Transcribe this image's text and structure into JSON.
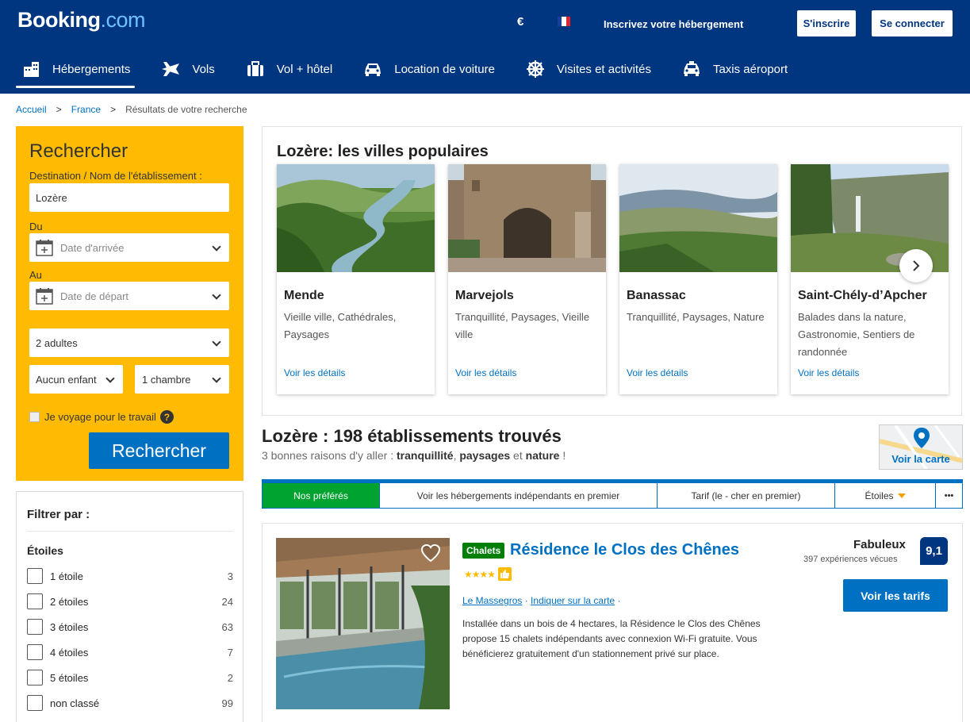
{
  "header": {
    "logo_main": "Booking",
    "logo_suffix": ".com",
    "currency": "€",
    "list_property": "Inscrivez votre hébergement",
    "signup": "S'inscrire",
    "login": "Se connecter"
  },
  "nav": {
    "tabs": [
      {
        "label": "Hébergements",
        "icon": "bed-icon"
      },
      {
        "label": "Vols",
        "icon": "plane-icon"
      },
      {
        "label": "Vol + hôtel",
        "icon": "suitcase-icon"
      },
      {
        "label": "Location de voiture",
        "icon": "car-icon"
      },
      {
        "label": "Visites et activités",
        "icon": "attractions-icon"
      },
      {
        "label": "Taxis aéroport",
        "icon": "taxi-icon"
      }
    ]
  },
  "breadcrumb": {
    "items": [
      "Accueil",
      "France"
    ],
    "current": "Résultats de votre recherche",
    "separator": ">"
  },
  "search": {
    "title": "Rechercher",
    "destination_label": "Destination / Nom de l'établissement :",
    "destination_value": "Lozère",
    "from_label": "Du",
    "checkin_placeholder": "Date d'arrivée",
    "to_label": "Au",
    "checkout_placeholder": "Date de départ",
    "adults": "2 adultes",
    "children": "Aucun enfant",
    "rooms": "1 chambre",
    "work_travel": "Je voyage pour le travail",
    "help": "?",
    "button": "Rechercher"
  },
  "filters": {
    "title": "Filtrer par :",
    "stars_heading": "Étoiles",
    "items": [
      {
        "label": "1 étoile",
        "count": "3"
      },
      {
        "label": "2 étoiles",
        "count": "24"
      },
      {
        "label": "3 étoiles",
        "count": "63"
      },
      {
        "label": "4 étoiles",
        "count": "7"
      },
      {
        "label": "5 étoiles",
        "count": "2"
      },
      {
        "label": "non classé",
        "count": "99"
      }
    ]
  },
  "popular": {
    "title": "Lozère: les villes populaires",
    "cities": [
      {
        "name": "Mende",
        "tags": "Vieille ville, Cathédrales, Paysages",
        "link": "Voir les détails"
      },
      {
        "name": "Marvejols",
        "tags": "Tranquillité, Paysages, Vieille ville",
        "link": "Voir les détails"
      },
      {
        "name": "Banassac",
        "tags": "Tranquillité, Paysages, Nature",
        "link": "Voir les détails"
      },
      {
        "name": "Saint-Chély-d’Apcher",
        "tags": "Balades dans la nature, Gastronomie, Sentiers de randonnée",
        "link": "Voir les détails"
      }
    ]
  },
  "results": {
    "title": "Lozère : 198 établissements trouvés",
    "sub_prefix": "3 bonnes raisons d'y aller : ",
    "reason1": "tranquillité",
    "sep1": ", ",
    "reason2": "paysages",
    "sep2": " et ",
    "reason3": "nature",
    "sub_suffix": " !",
    "map_link": "Voir la carte"
  },
  "sort": {
    "items": [
      "Nos préférés",
      "Voir les hébergements indépendants en premier",
      "Tarif (le - cher en premier)",
      "Étoiles",
      "•••"
    ]
  },
  "property": {
    "type_badge": "Chalets",
    "name": "Résidence le Clos des Chênes",
    "stars": "★★★★",
    "location": "Le Massegros",
    "map_link": "Indiquer sur la carte",
    "description": "Installée dans un bois de 4 hectares, la Résidence le Clos des Chênes propose 15 chalets indépendants avec connexion Wi-Fi gratuite. Vous bénéficierez gratuitement d'un stationnement privé sur place.",
    "rating_word": "Fabuleux",
    "rating_count": "397 expériences vécues",
    "score": "9,1",
    "cta": "Voir les tarifs"
  },
  "colors": {
    "brand_blue": "#003580",
    "link_blue": "#0071c2",
    "search_yellow": "#febb02",
    "active_green": "#00a32f"
  }
}
